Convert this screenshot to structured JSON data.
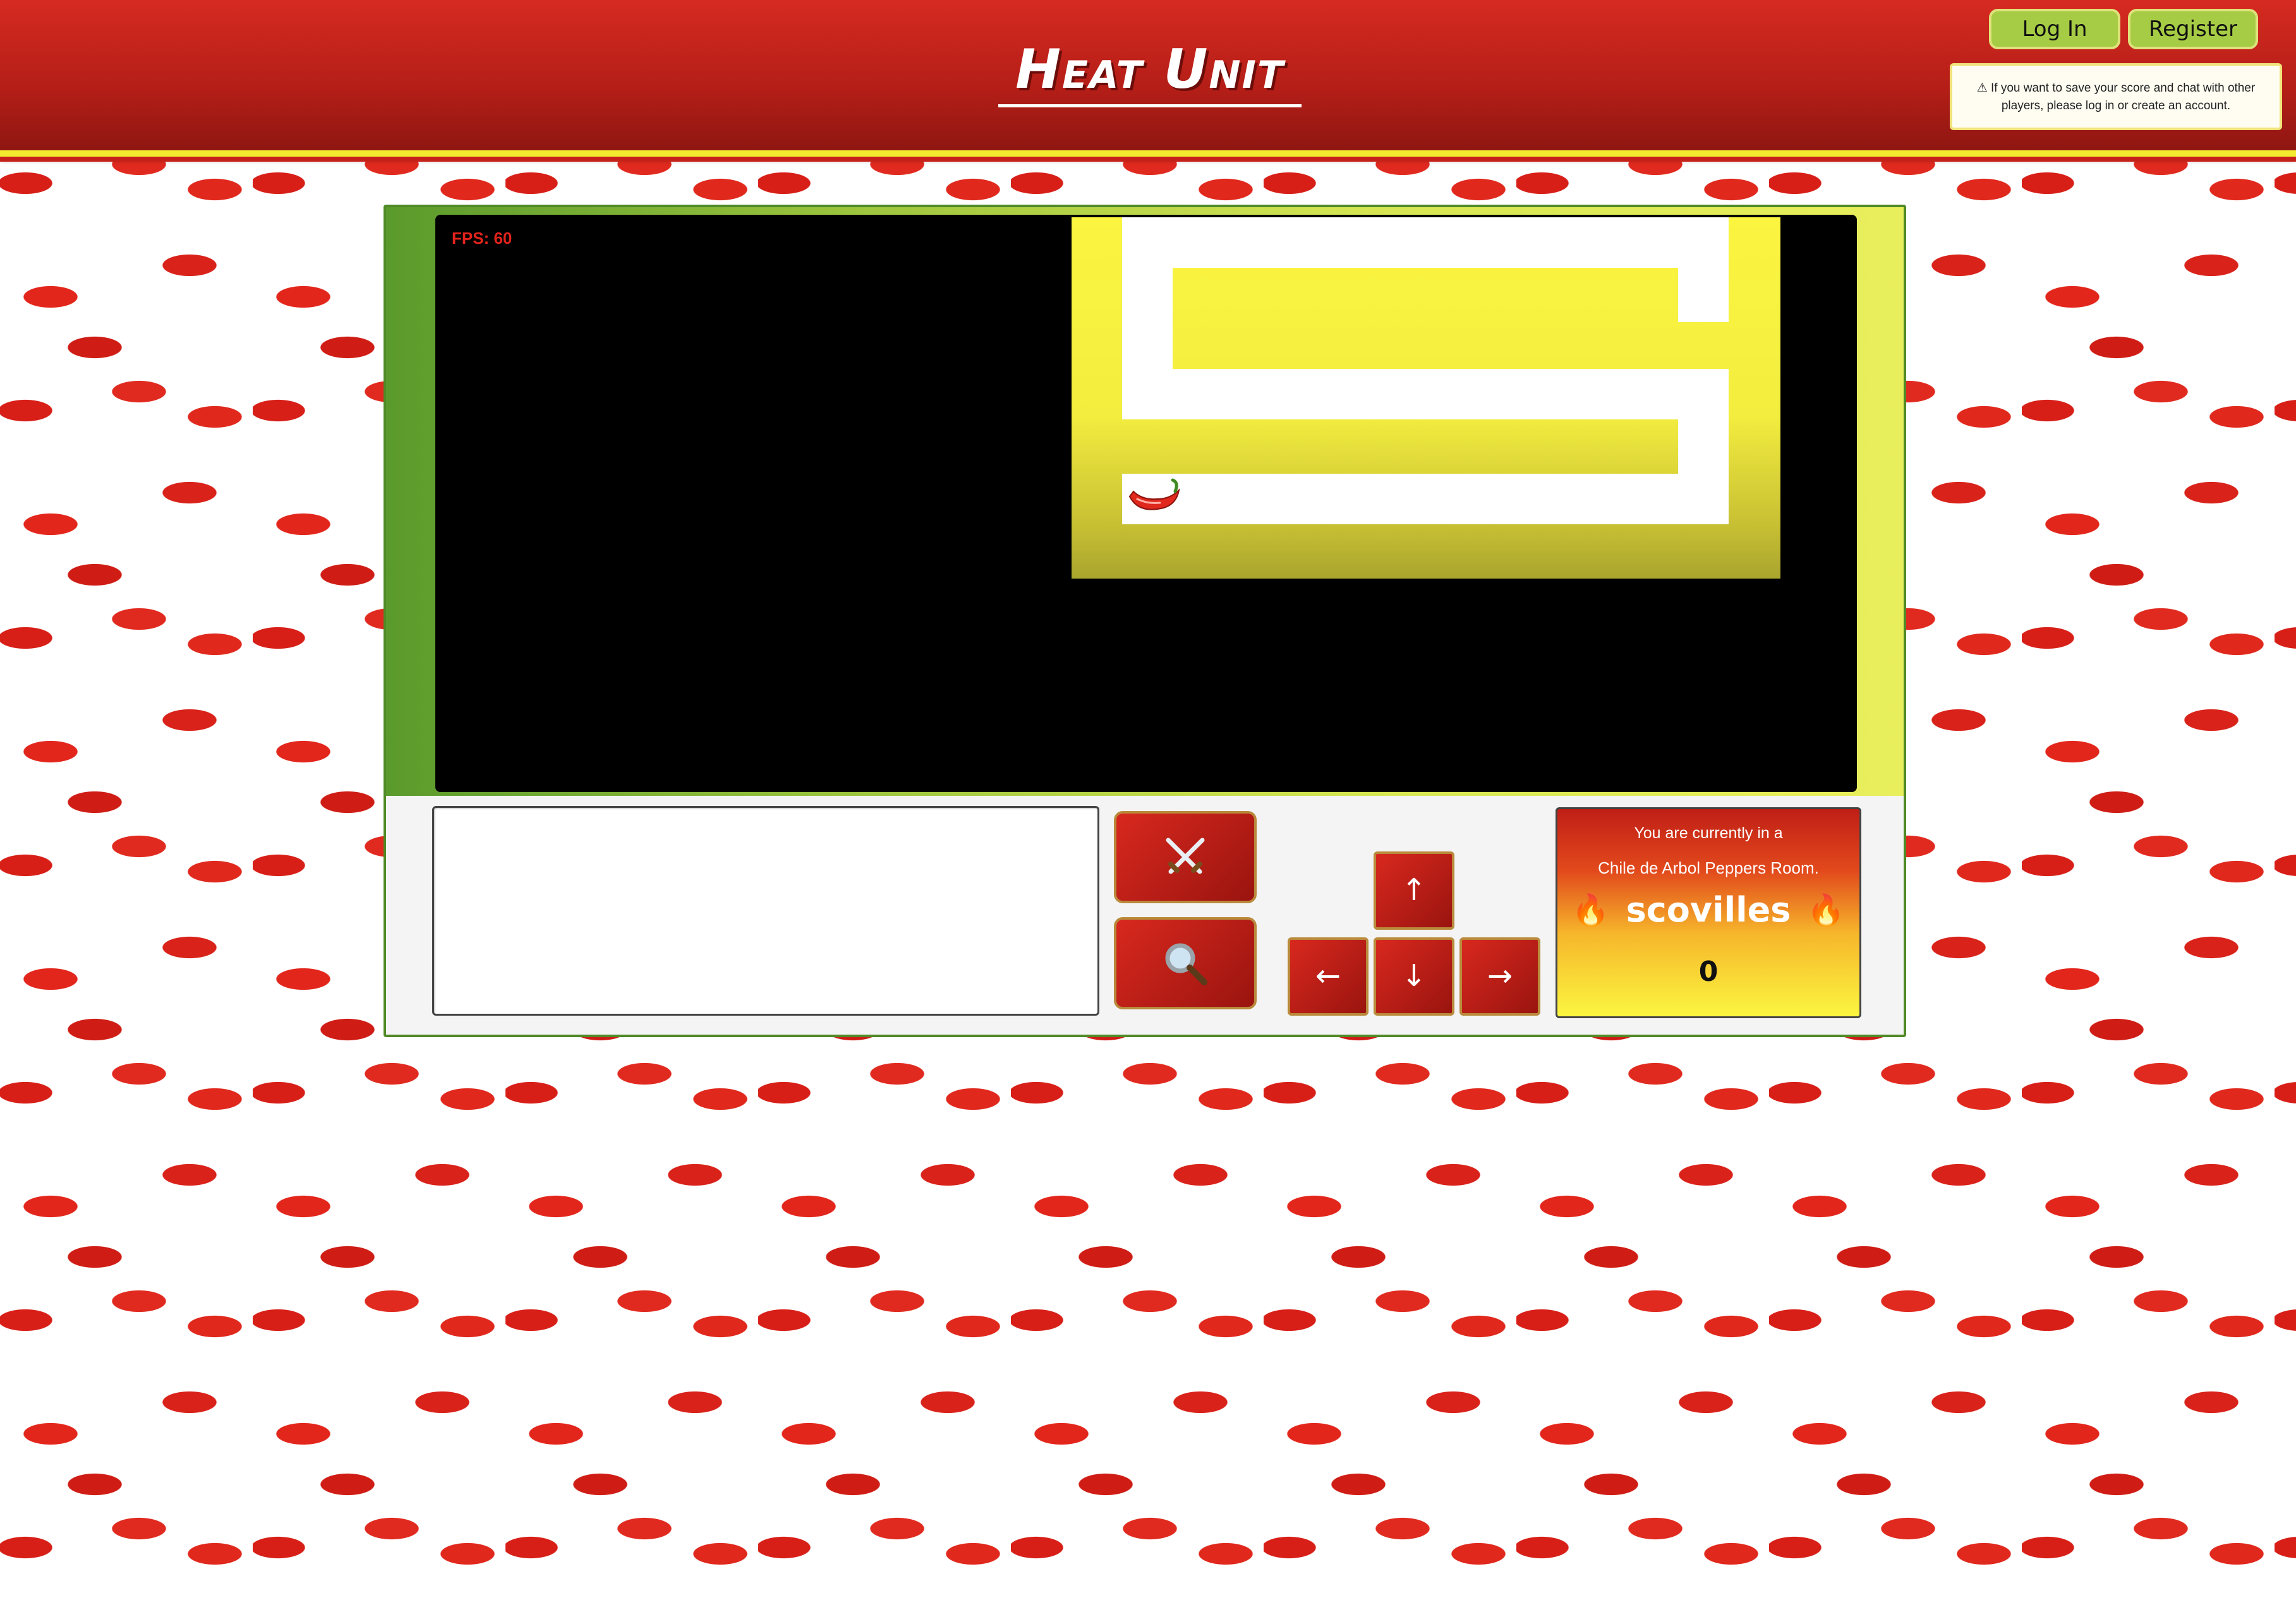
{
  "header": {
    "title": "Heat Unit",
    "login_label": "Log In",
    "register_label": "Register",
    "notice": "⚠ If you want to save your score and chat with other players, please log in or create an account."
  },
  "game": {
    "fps_label": "FPS: 60",
    "player_icon": "chili-pepper-icon"
  },
  "controls": {
    "attack_icon": "crossed-swords-icon",
    "search_icon": "magnifying-glass-icon",
    "up": "↑",
    "left": "←",
    "down": "↓",
    "right": "→"
  },
  "room": {
    "line1": "You are currently in a",
    "line2": "Chile de Arbol Peppers Room.",
    "scoville_label": "scovilles",
    "flame_icon": "fire-icon",
    "score": "0"
  },
  "colors": {
    "header_red": "#b31e17",
    "accent_yellow": "#f4ec2f",
    "button_green": "#a6cc45",
    "frame_green": "#4f8a26"
  }
}
